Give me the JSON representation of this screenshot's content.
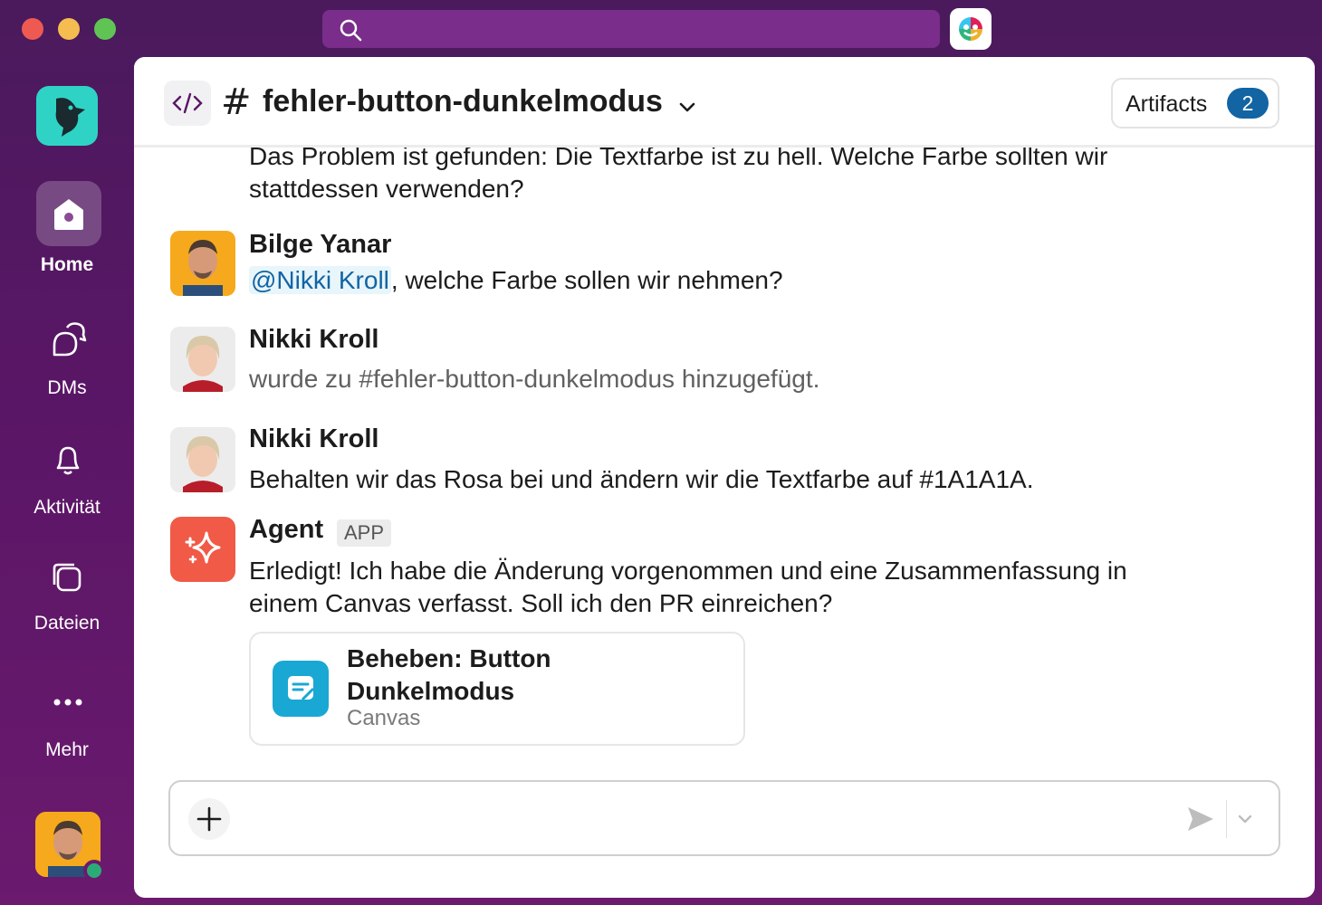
{
  "titlebar": {
    "search_placeholder": ""
  },
  "sidebar": {
    "items": [
      {
        "label": "Home",
        "icon": "home-icon",
        "active": true
      },
      {
        "label": "DMs",
        "icon": "dms-icon"
      },
      {
        "label": "Aktivität",
        "icon": "bell-icon"
      },
      {
        "label": "Dateien",
        "icon": "files-icon"
      },
      {
        "label": "Mehr",
        "icon": "more-icon"
      }
    ]
  },
  "header": {
    "channel_prefix": "#",
    "channel_name": "fehler-button-dunkelmodus",
    "artifacts_label": "Artifacts",
    "artifacts_count": "2"
  },
  "messages": [
    {
      "text": "Das Problem ist gefunden: Die Textfarbe ist zu hell. Welche Farbe sollten wir stattdessen verwenden?"
    },
    {
      "author": "Bilge Yanar",
      "mention": "@Nikki Kroll",
      "text": ", welche Farbe sollen wir nehmen?"
    },
    {
      "author": "Nikki Kroll",
      "text": "wurde zu #fehler-button-dunkelmodus hinzugefügt."
    },
    {
      "author": "Nikki Kroll",
      "text": "Behalten wir das Rosa bei und ändern wir die Textfarbe auf #1A1A1A."
    },
    {
      "author": "Agent",
      "badge": "APP",
      "text": "Erledigt! Ich habe die Änderung vorgenommen und eine Zusammenfassung in einem Canvas verfasst. Soll ich den PR einreichen?"
    }
  ],
  "canvas_card": {
    "title": "Beheben: Button Dunkelmodus",
    "type": "Canvas"
  },
  "composer": {
    "placeholder": ""
  },
  "colors": {
    "sidebar_bg": "#5a1666",
    "search_bg": "#7a2d8a",
    "mention": "#1264a3",
    "badge": "#1264a3",
    "agent": "#f05a46",
    "canvas": "#19a8d4",
    "presence": "#2bac76"
  }
}
